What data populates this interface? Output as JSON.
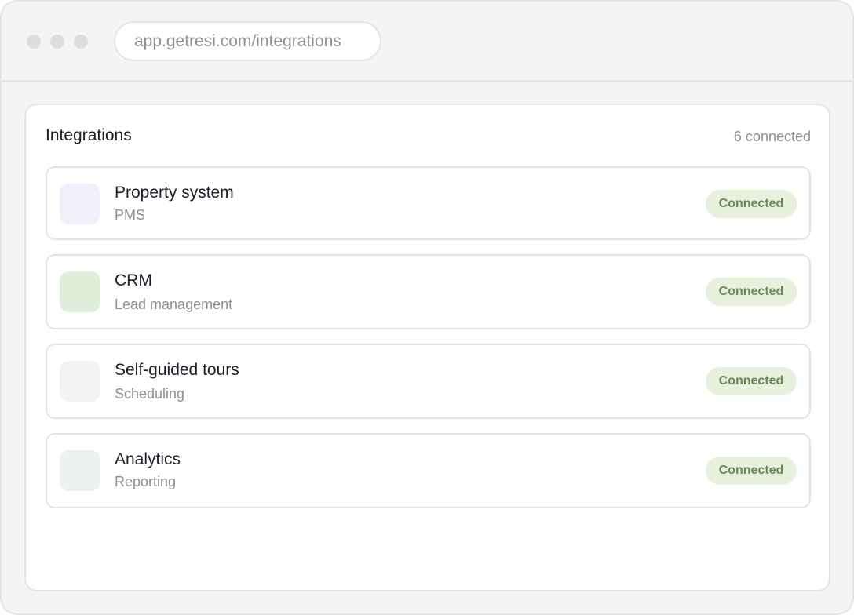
{
  "browser": {
    "url": "app.getresi.com/integrations"
  },
  "integrations_panel": {
    "title": "Integrations",
    "count_text": "6 connected",
    "items": [
      {
        "name": "Property system",
        "subtitle": "PMS",
        "status": "Connected",
        "icon_color": "#f1eff9"
      },
      {
        "name": "CRM",
        "subtitle": "Lead management",
        "status": "Connected",
        "icon_color": "#dfeeda"
      },
      {
        "name": "Self-guided tours",
        "subtitle": "Scheduling",
        "status": "Connected",
        "icon_color": "#f4f3f1"
      },
      {
        "name": "Analytics",
        "subtitle": "Reporting",
        "status": "Connected",
        "icon_color": "#ebf0f1"
      }
    ]
  },
  "colors": {
    "status_badge_bg": "#e6f0dd",
    "status_badge_text": "#6a8a58"
  }
}
